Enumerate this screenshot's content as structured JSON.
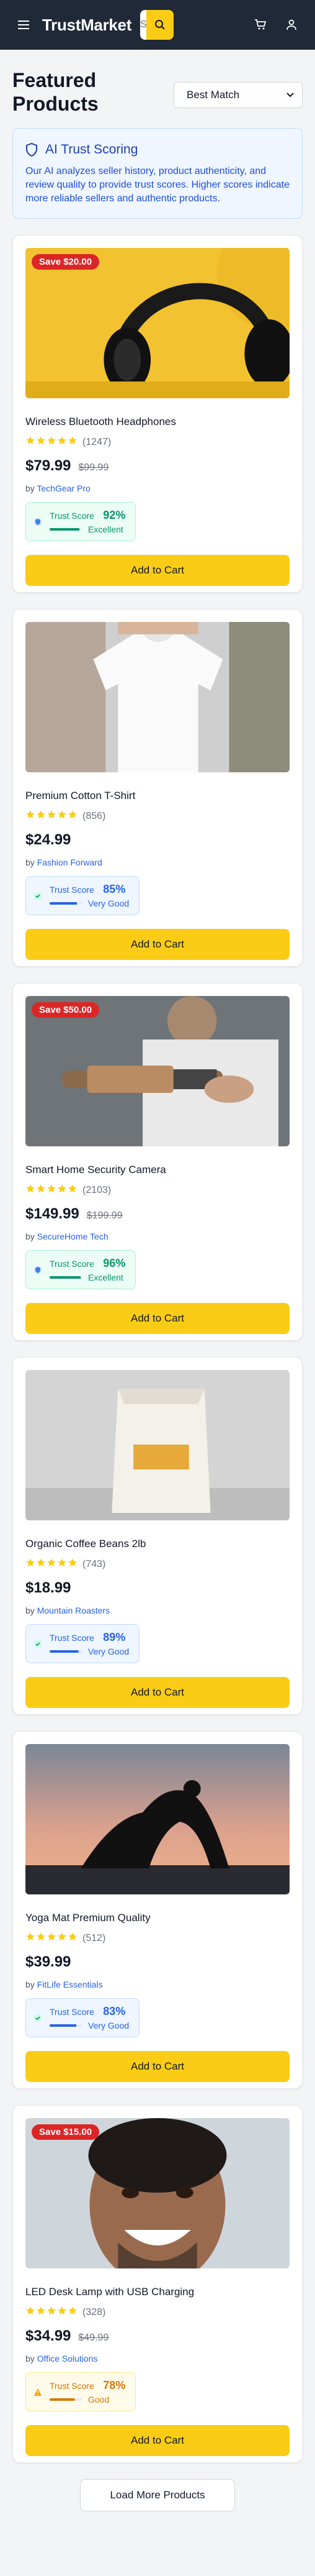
{
  "header": {
    "brand": "TrustMarket",
    "search_placeholder": "Search"
  },
  "page": {
    "title": "Featured Products",
    "sort_selected": "Best Match"
  },
  "info": {
    "title": "AI Trust Scoring",
    "text": "Our AI analyzes seller history, product authenticity, and review quality to provide trust scores. Higher scores indicate more reliable sellers and authentic products."
  },
  "products": [
    {
      "sale": "Save $20.00",
      "name": "Wireless Bluetooth Headphones",
      "rating": 4.5,
      "reviews": "(1247)",
      "price": "$79.99",
      "old_price": "$99.99",
      "by": "by",
      "seller": "TechGear Pro",
      "trust_label": "Trust Score",
      "trust_score": "92%",
      "trust_level": "Excellent",
      "add_label": "Add to Cart"
    },
    {
      "sale": "",
      "name": "Premium Cotton T-Shirt",
      "rating": 4.5,
      "reviews": "(856)",
      "price": "$24.99",
      "old_price": "",
      "by": "by",
      "seller": "Fashion Forward",
      "trust_label": "Trust Score",
      "trust_score": "85%",
      "trust_level": "Very Good",
      "add_label": "Add to Cart"
    },
    {
      "sale": "Save $50.00",
      "name": "Smart Home Security Camera",
      "rating": 4.5,
      "reviews": "(2103)",
      "price": "$149.99",
      "old_price": "$199.99",
      "by": "by",
      "seller": "SecureHome Tech",
      "trust_label": "Trust Score",
      "trust_score": "96%",
      "trust_level": "Excellent",
      "add_label": "Add to Cart"
    },
    {
      "sale": "",
      "name": "Organic Coffee Beans 2lb",
      "rating": 4.5,
      "reviews": "(743)",
      "price": "$18.99",
      "old_price": "",
      "by": "by",
      "seller": "Mountain Roasters",
      "trust_label": "Trust Score",
      "trust_score": "89%",
      "trust_level": "Very Good",
      "add_label": "Add to Cart"
    },
    {
      "sale": "",
      "name": "Yoga Mat Premium Quality",
      "rating": 4.5,
      "reviews": "(512)",
      "price": "$39.99",
      "old_price": "",
      "by": "by",
      "seller": "FitLife Essentials",
      "trust_label": "Trust Score",
      "trust_score": "83%",
      "trust_level": "Very Good",
      "add_label": "Add to Cart"
    },
    {
      "sale": "Save $15.00",
      "name": "LED Desk Lamp with USB Charging",
      "rating": 4.5,
      "reviews": "(328)",
      "price": "$34.99",
      "old_price": "$49.99",
      "by": "by",
      "seller": "Office Solutions",
      "trust_label": "Trust Score",
      "trust_score": "78%",
      "trust_level": "Good",
      "add_label": "Add to Cart"
    }
  ],
  "load_more": "Load More Products",
  "colors": {
    "header_bg": "#1f2937",
    "accent": "#facc15",
    "sale_badge": "#dc2626",
    "excellent": "#059669",
    "very_good": "#2563eb",
    "good": "#d97706"
  }
}
